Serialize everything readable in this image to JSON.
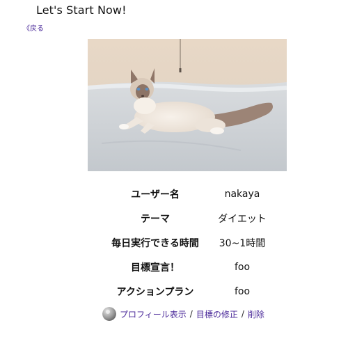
{
  "header": {
    "title": "Let's Start Now!",
    "back_label": "《戻る"
  },
  "photo": {
    "subject": "cat-photo"
  },
  "profile": {
    "rows": [
      {
        "label": "ユーザー名",
        "value": "nakaya"
      },
      {
        "label": "テーマ",
        "value": "ダイエット"
      },
      {
        "label": "毎日実行できる時間",
        "value": "30~1時間"
      },
      {
        "label": "目標宣言！",
        "value": "foo"
      },
      {
        "label": "アクションプラン",
        "value": "foo"
      }
    ]
  },
  "footer": {
    "avatar_icon": "user-avatar-icon",
    "links": [
      {
        "label": "プロフィール表示"
      },
      {
        "label": "目標の修正"
      },
      {
        "label": "削除"
      }
    ],
    "separator": "/"
  },
  "colors": {
    "link": "#4b2a9a",
    "text": "#111111",
    "background": "#ffffff"
  }
}
